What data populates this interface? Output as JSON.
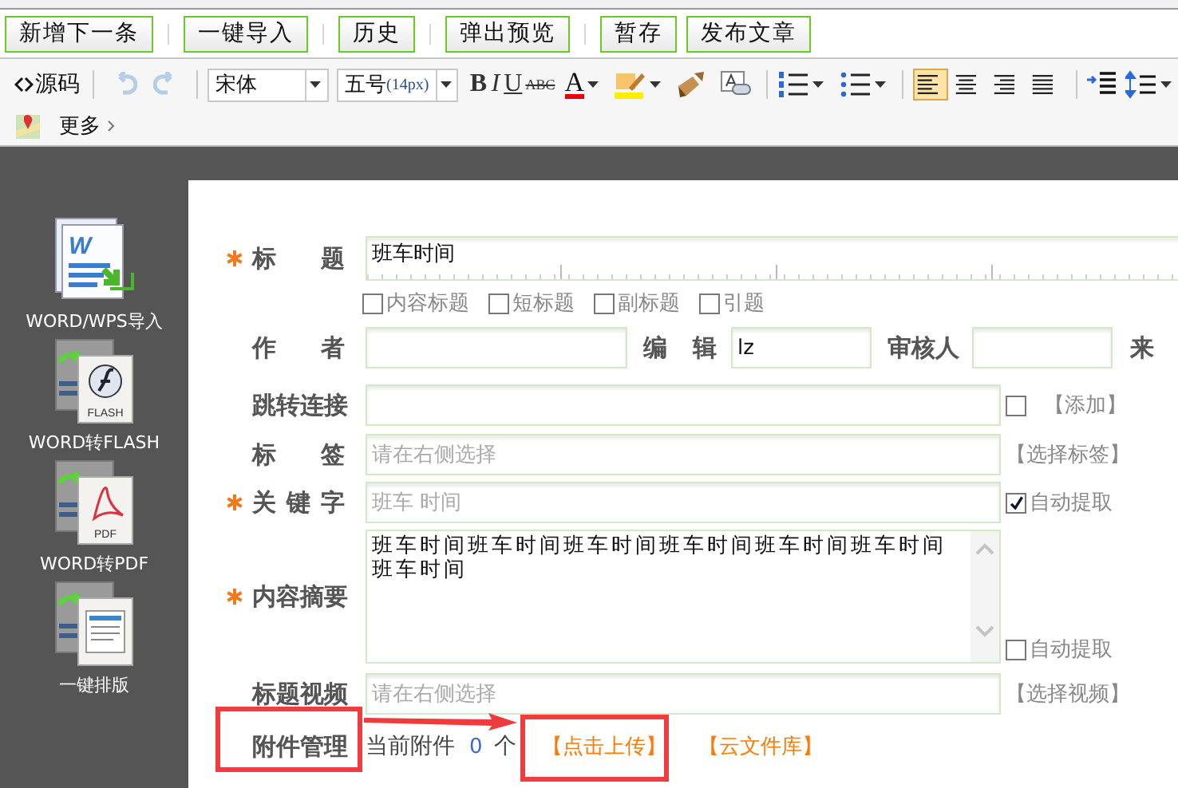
{
  "action_buttons": [
    "新增下一条",
    "一键导入",
    "历史",
    "弹出预览",
    "暂存",
    "发布文章"
  ],
  "toolbar": {
    "source": "源码",
    "history": [
      {
        "kind": "undo",
        "disabled": true
      },
      {
        "kind": "redo",
        "disabled": true
      }
    ],
    "font": "宋体",
    "size": "五号",
    "size_px": "(14px)",
    "styles": [
      {
        "kind": "bold",
        "label": "B"
      },
      {
        "kind": "italic",
        "label": "I"
      },
      {
        "kind": "underline",
        "label": "U"
      },
      {
        "kind": "strike",
        "label": "ABC"
      }
    ],
    "font_color": "A",
    "align": [
      {
        "kind": "left",
        "selected": true
      },
      {
        "kind": "center",
        "selected": false
      },
      {
        "kind": "right",
        "selected": false
      },
      {
        "kind": "justify",
        "selected": false
      }
    ],
    "more": "更多"
  },
  "sidebar": [
    {
      "kind": "word",
      "icon_text": "W",
      "label": "WORD/WPS导入"
    },
    {
      "kind": "flash",
      "icon_text": "FLASH",
      "label": "WORD转FLASH"
    },
    {
      "kind": "pdf",
      "icon_text": "PDF",
      "label": "WORD转PDF"
    },
    {
      "kind": "layout",
      "label": "一键排版"
    }
  ],
  "form": {
    "rows": [
      {
        "kind": "title",
        "required": true,
        "label": "标 题",
        "value": "班车时间"
      },
      {
        "kind": "options",
        "options": [
          {
            "label": "内容标题",
            "checked": false
          },
          {
            "label": "短标题",
            "checked": false
          },
          {
            "label": "副标题",
            "checked": false
          },
          {
            "label": "引题",
            "checked": false
          }
        ]
      },
      {
        "kind": "people",
        "fields": [
          {
            "label": "作 者"
          },
          {
            "label": "编 辑",
            "value": "lz"
          },
          {
            "label": "审核人"
          }
        ],
        "tail": "来"
      },
      {
        "kind": "text",
        "label": "跳转连接",
        "checkbox": {
          "checked": false
        },
        "action": "【添加】"
      },
      {
        "kind": "text",
        "label": "标 签",
        "placeholder": "请在右侧选择",
        "action": "【选择标签】"
      },
      {
        "kind": "text",
        "required": true,
        "label": "关 键 字",
        "placeholder": "班车 时间",
        "auto": {
          "label": "自动提取",
          "checked": true
        }
      },
      {
        "kind": "summary",
        "required": true,
        "label": "内容摘要",
        "value": "班车时间班车时间班车时间班车时间班车时间班车时间班车时间",
        "auto": {
          "label": "自动提取",
          "checked": false
        }
      },
      {
        "kind": "text",
        "label": "标题视频",
        "placeholder": "请在右侧选择",
        "action": "【选择视频】"
      },
      {
        "kind": "attachments",
        "label": "附件管理",
        "prefix": "当前附件",
        "count": "0",
        "unit": "个",
        "links": [
          "【点击上传】",
          "【云文件库】"
        ]
      }
    ]
  }
}
